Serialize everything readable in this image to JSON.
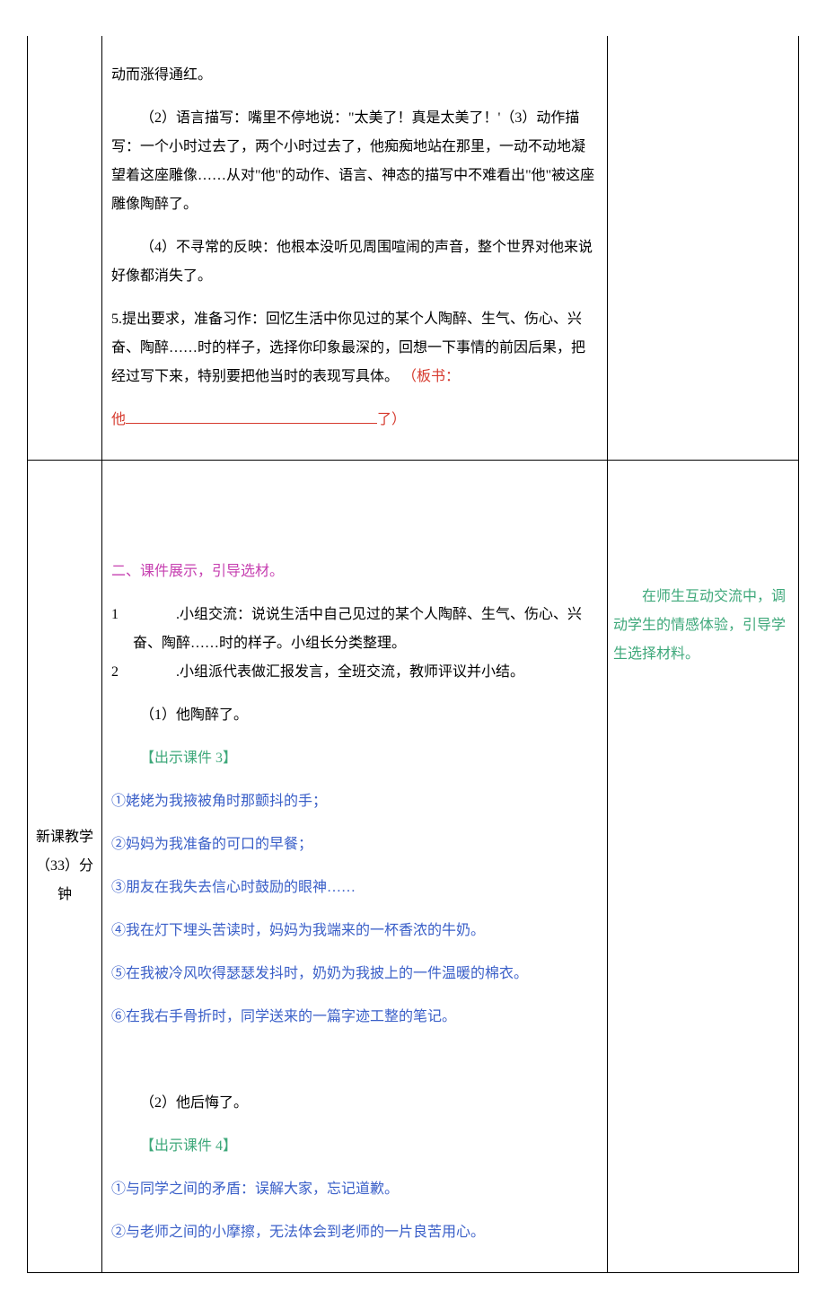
{
  "row1": {
    "mid": {
      "p1": "动而涨得通红。",
      "p2": "（2）语言描写：嘴里不停地说：\"太美了！真是太美了！'（3）动作描写：一个小时过去了，两个小时过去了，他痴痴地站在那里，一动不动地凝望着这座雕像……从对\"他\"的动作、语言、神态的描写中不难看出\"他\"被这座雕像陶醉了。",
      "p3": "（4）不寻常的反映：他根本没听见周围喧闹的声音，整个世界对他来说好像都消失了。",
      "p4": "5.提出要求，准备习作：回忆生活中你见过的某个人陶醉、生气、伤心、兴奋、陶醉……时的样子，选择你印象最深的，回想一下事情的前因后果，把经过写下来，特别要把他当时的表现写具体。",
      "board_prefix": "（板书：",
      "board_he": "他",
      "board_le": "了）"
    }
  },
  "row2": {
    "left": "新课教学（33）分钟",
    "mid": {
      "heading": "二、课件展示，引导选材。",
      "item1_num": "1",
      "item1_txt": ".小组交流：说说生活中自己见过的某个人陶醉、生气、伤心、兴奋、陶醉……时的样子。小组长分类整理。",
      "item2_num": "2",
      "item2_txt": ".小组派代表做汇报发言，全班交流，教师评议并小结。",
      "sub1": "（1）他陶醉了。",
      "show3": "【出示课件 3】",
      "b1": "①姥姥为我掖被角时那颤抖的手；",
      "b2": "②妈妈为我准备的可口的早餐；",
      "b3": "③朋友在我失去信心时鼓励的眼神……",
      "b4": "④我在灯下埋头苦读时，妈妈为我端来的一杯香浓的牛奶。",
      "b5": "⑤在我被冷风吹得瑟瑟发抖时，奶奶为我披上的一件温暖的棉衣。",
      "b6": "⑥在我右手骨折时，同学送来的一篇字迹工整的笔记。",
      "sub2": "（2）他后悔了。",
      "show4": "【出示课件 4】",
      "c1": "①与同学之间的矛盾：误解大家，忘记道歉。",
      "c2": "②与老师之间的小摩擦，无法体会到老师的一片良苦用心。"
    },
    "right": "在师生互动交流中，调动学生的情感体验，引导学生选择材料。"
  }
}
